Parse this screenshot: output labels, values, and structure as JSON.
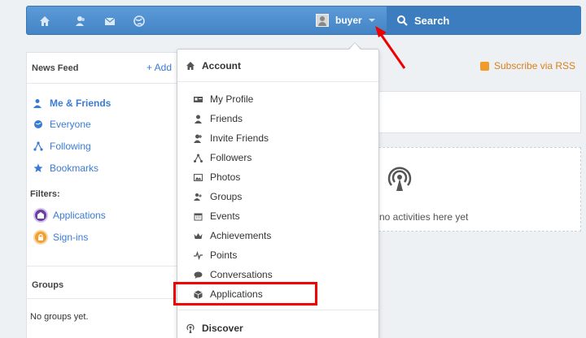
{
  "topbar": {
    "username": "buyer",
    "search_label": "Search"
  },
  "left": {
    "news_feed_title": "News Feed",
    "add_label": "+ Add",
    "feed_items": [
      "Me & Friends",
      "Everyone",
      "Following",
      "Bookmarks"
    ],
    "filters_title": "Filters:",
    "filter_items": [
      "Applications",
      "Sign-ins"
    ],
    "groups_title": "Groups",
    "no_groups": "No groups yet."
  },
  "right": {
    "rss_label": "Subscribe via RSS",
    "empty_text": "no activities here yet"
  },
  "dropdown": {
    "account_title": "Account",
    "items": [
      "My Profile",
      "Friends",
      "Invite Friends",
      "Followers",
      "Photos",
      "Groups",
      "Events",
      "Achievements",
      "Points",
      "Conversations",
      "Applications"
    ],
    "discover_title": "Discover"
  },
  "colors": {
    "topbar": "#4a8ccd",
    "link": "#3a7bd5",
    "highlight": "#ee0000",
    "rss": "#d9801d"
  }
}
